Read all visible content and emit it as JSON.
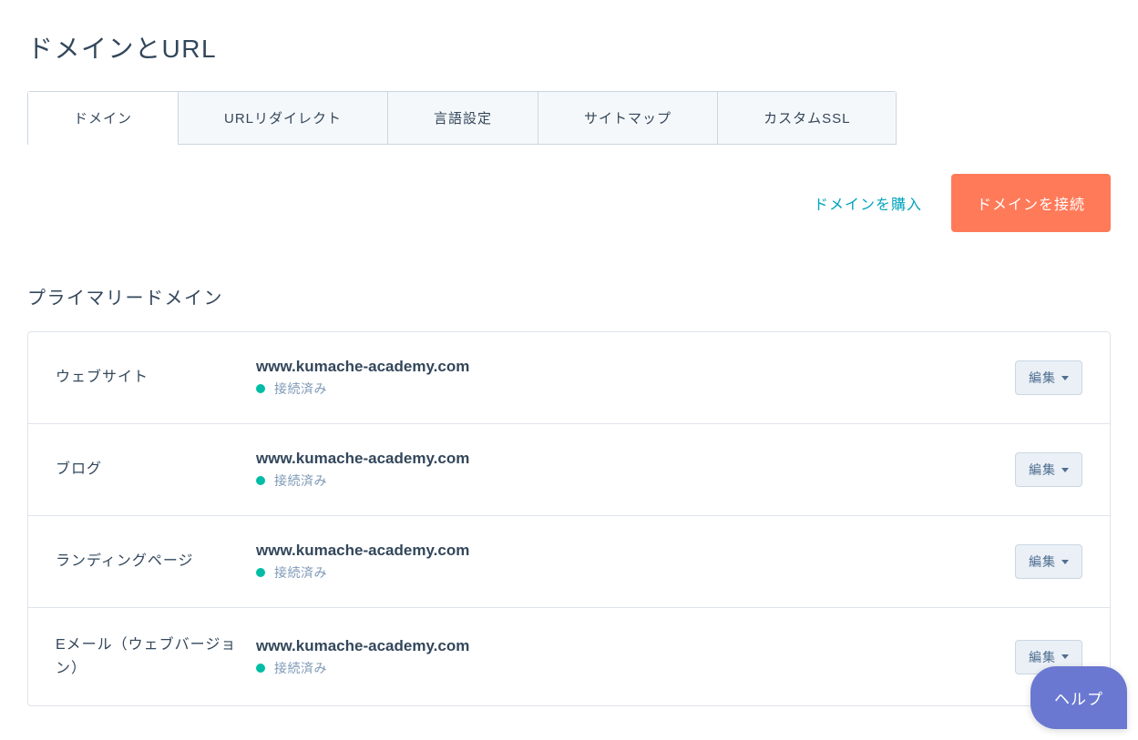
{
  "pageTitle": "ドメインとURL",
  "tabs": {
    "domains": "ドメイン",
    "urlRedirect": "URLリダイレクト",
    "language": "言語設定",
    "sitemap": "サイトマップ",
    "customSsl": "カスタムSSL"
  },
  "actions": {
    "buyDomain": "ドメインを購入",
    "connectDomain": "ドメインを接続"
  },
  "section": {
    "primaryDomainHeading": "プライマリードメイン"
  },
  "rows": [
    {
      "label": "ウェブサイト",
      "domain": "www.kumache-academy.com",
      "status": "接続済み",
      "edit": "編集"
    },
    {
      "label": "ブログ",
      "domain": "www.kumache-academy.com",
      "status": "接続済み",
      "edit": "編集"
    },
    {
      "label": "ランディングページ",
      "domain": "www.kumache-academy.com",
      "status": "接続済み",
      "edit": "編集"
    },
    {
      "label": "Eメール（ウェブバージョン）",
      "domain": "www.kumache-academy.com",
      "status": "接続済み",
      "edit": "編集"
    }
  ],
  "help": {
    "label": "ヘルプ"
  }
}
